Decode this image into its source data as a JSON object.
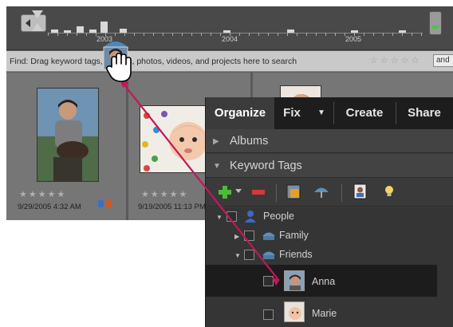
{
  "timeline": {
    "years": [
      "2003",
      "2004",
      "2005"
    ],
    "bars": [
      0.15,
      0.1,
      0.3,
      0.15,
      0.55,
      0.2,
      0.1,
      0.15,
      0.1,
      0.1
    ]
  },
  "find_bar": {
    "text": "Find: Drag keyword tags, albums, photos, videos, and projects here to search",
    "rating_stars": "☆☆☆☆☆",
    "menu_label": "and"
  },
  "photos": [
    {
      "stars": "★★★★★",
      "date": "9/29/2005 4:32 AM"
    },
    {
      "stars": "★★★★★",
      "date": "9/19/2005 11:13 PM"
    }
  ],
  "panel": {
    "tabs": [
      "Organize",
      "Fix",
      "Create",
      "Share"
    ],
    "tab_dropdown": "▼",
    "sections": {
      "albums": "Albums",
      "keyword_tags": "Keyword Tags"
    },
    "tags": {
      "people": "People",
      "family": "Family",
      "friends": "Friends",
      "anna": "Anna",
      "marie": "Marie"
    }
  },
  "colors": {
    "accent_arrow": "#c2185b",
    "panel_bg": "#3c3c3c",
    "tab_bar": "#1d1d1d",
    "selected_row": "#1c1c1c"
  }
}
